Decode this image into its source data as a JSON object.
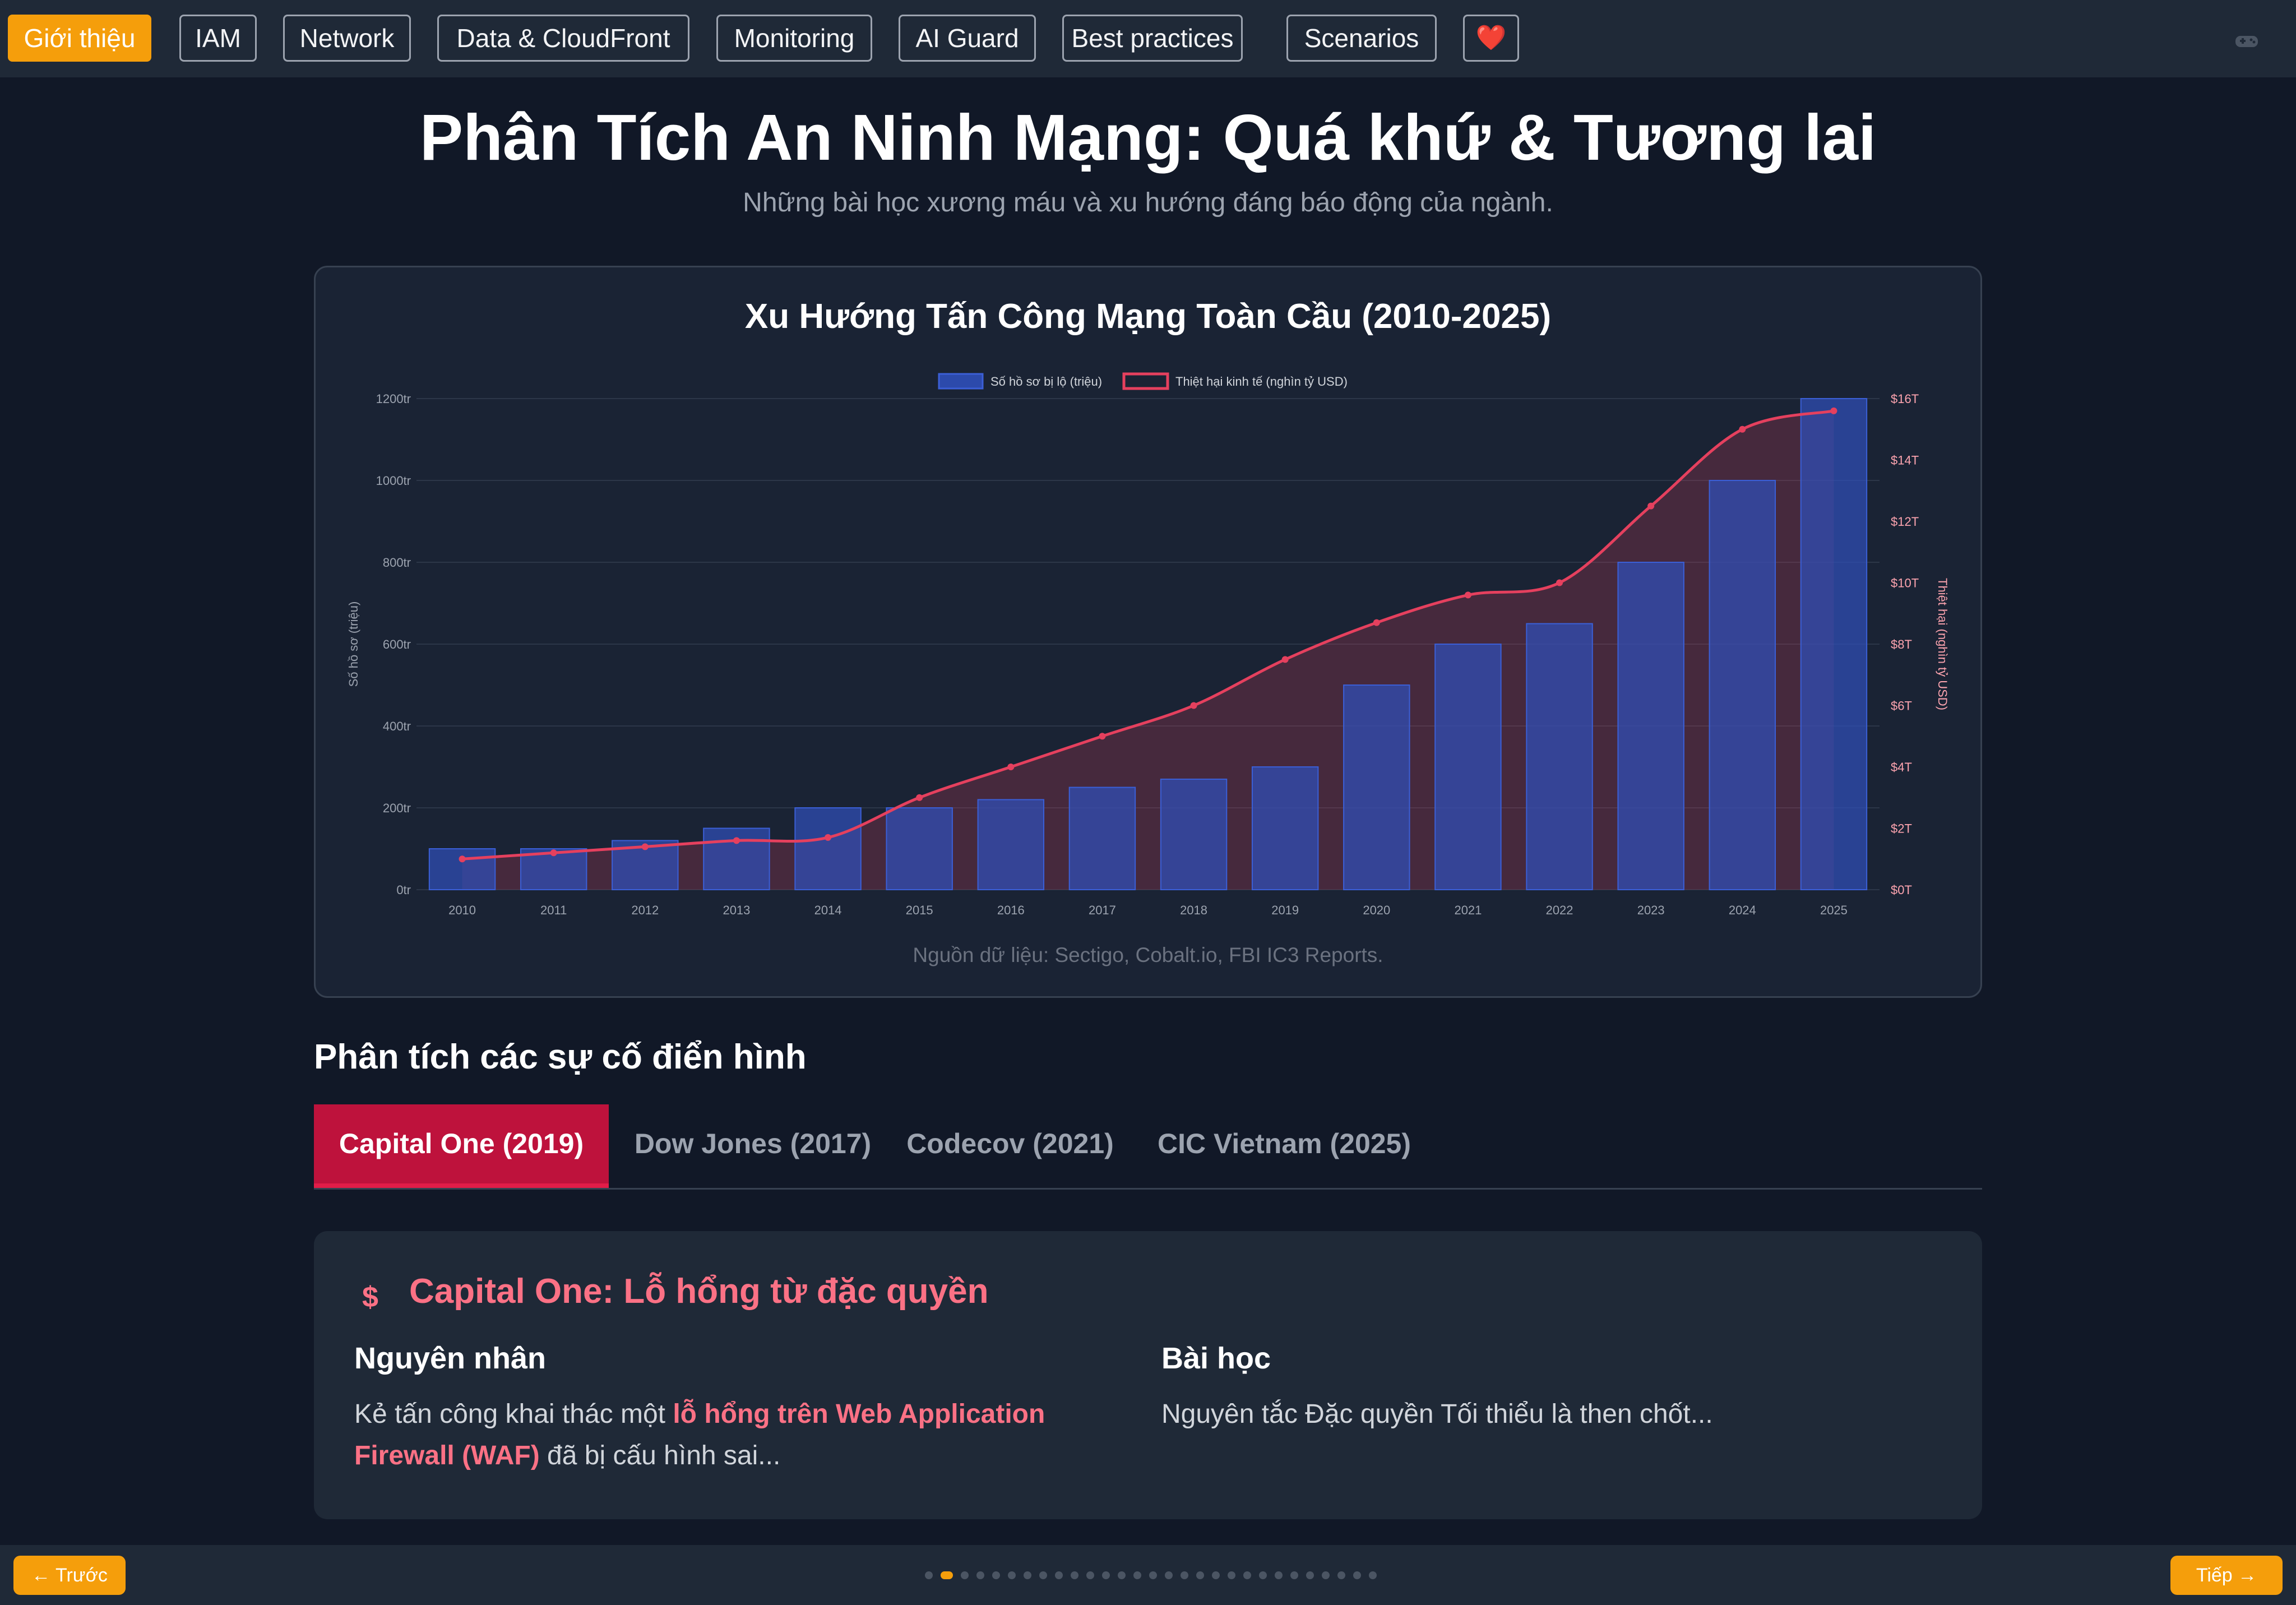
{
  "nav": {
    "items": [
      {
        "label": "Giới thiệu",
        "active": true
      },
      {
        "label": "IAM",
        "active": false
      },
      {
        "label": "Network",
        "active": false
      },
      {
        "label": "Data & CloudFront",
        "active": false
      },
      {
        "label": "Monitoring",
        "active": false
      },
      {
        "label": "AI Guard",
        "active": false
      },
      {
        "label": "Best practices",
        "active": false
      },
      {
        "label": "Scenarios",
        "active": false
      }
    ],
    "heart_icon": "❤️",
    "game_icon": "gamepad-icon"
  },
  "header": {
    "title": "Phân Tích An Ninh Mạng: Quá khứ & Tương lai",
    "subtitle": "Những bài học xương máu và xu hướng đáng báo động của ngành."
  },
  "chart_data": {
    "type": "bar",
    "title": "Xu Hướng Tấn Công Mạng Toàn Cầu (2010-2025)",
    "categories": [
      "2010",
      "2011",
      "2012",
      "2013",
      "2014",
      "2015",
      "2016",
      "2017",
      "2018",
      "2019",
      "2020",
      "2021",
      "2022",
      "2023",
      "2024",
      "2025"
    ],
    "series": [
      {
        "name": "Số hồ sơ bị lộ (triệu)",
        "type": "bar",
        "axis": "left",
        "color": "#2f4fb8",
        "values": [
          100,
          100,
          120,
          150,
          200,
          200,
          220,
          250,
          270,
          300,
          500,
          600,
          650,
          800,
          1000,
          1200
        ]
      },
      {
        "name": "Thiệt hại kinh tế (nghìn tỷ USD)",
        "type": "line",
        "axis": "right",
        "color": "#e5405e",
        "values": [
          1.0,
          1.2,
          1.4,
          1.6,
          1.7,
          3.0,
          4.0,
          5.0,
          6.0,
          7.5,
          8.7,
          9.6,
          10.0,
          12.5,
          15.0,
          15.6
        ]
      }
    ],
    "ylabel": "Số hồ sơ (triệu)",
    "ylabel_right": "Thiệt hại (nghìn tỷ USD)",
    "ylim": [
      0,
      1200
    ],
    "ylim_right": [
      0,
      16
    ],
    "yticks": [
      "0tr",
      "200tr",
      "400tr",
      "600tr",
      "800tr",
      "1000tr",
      "1200tr"
    ],
    "yticks_right": [
      "$0T",
      "$2T",
      "$4T",
      "$6T",
      "$8T",
      "$10T",
      "$12T",
      "$14T",
      "$16T"
    ],
    "grid": true,
    "legend": "top-center",
    "source": "Nguồn dữ liệu: Sectigo, Cobalt.io, FBI IC3 Reports."
  },
  "incidents": {
    "section_title": "Phân tích các sự cố điển hình",
    "tabs": [
      {
        "label": "Capital One (2019)",
        "active": true
      },
      {
        "label": "Dow Jones (2017)",
        "active": false
      },
      {
        "label": "Codecov (2021)",
        "active": false
      },
      {
        "label": "CIC Vietnam (2025)",
        "active": false
      }
    ],
    "detail": {
      "icon": "dollar-icon",
      "icon_glyph": "$",
      "title": "Capital One: Lỗ hổng từ đặc quyền",
      "cause_title": "Nguyên nhân",
      "cause_pre": "Kẻ tấn công khai thác một ",
      "cause_highlight": "lỗ hổng trên Web Application Firewall (WAF)",
      "cause_post": " đã bị cấu hình sai...",
      "lesson_title": "Bài học",
      "lesson_text": "Nguyên tắc Đặc quyền Tối thiểu là then chốt..."
    }
  },
  "footer": {
    "prev_label": "← Trước",
    "next_label": "Tiếp →",
    "slide_count": 29,
    "current_slide": 2
  }
}
